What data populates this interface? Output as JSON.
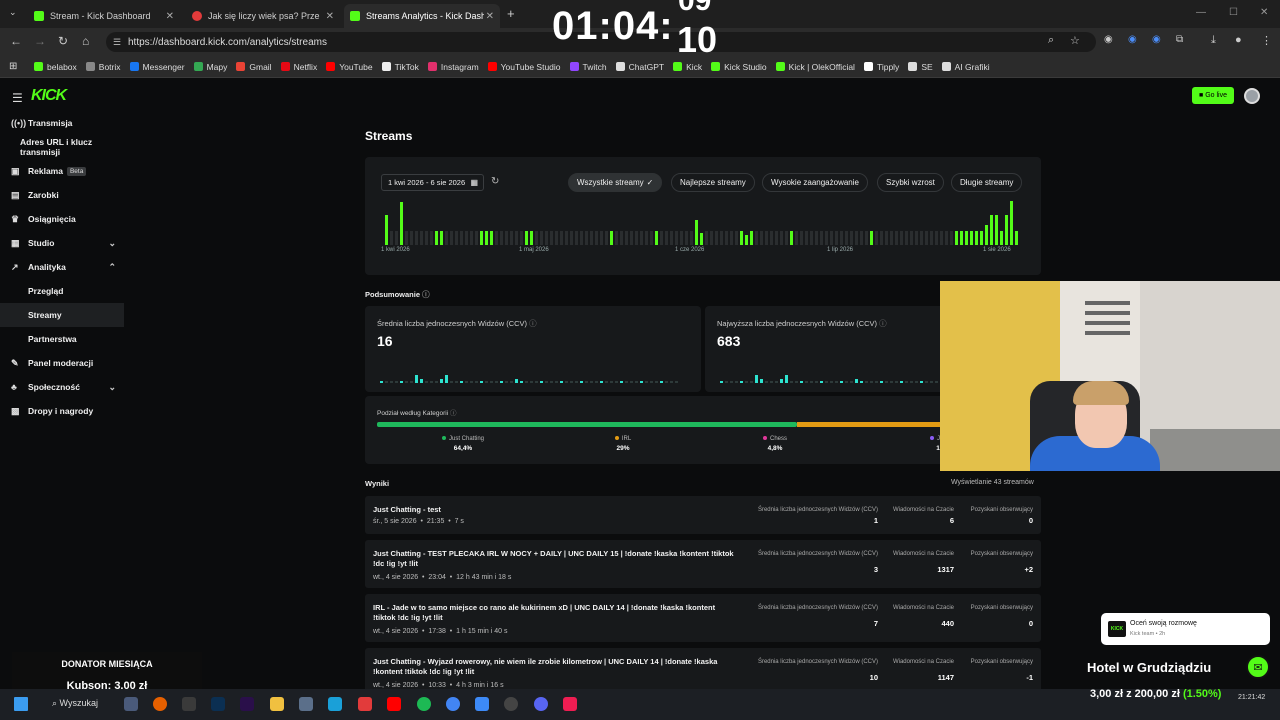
{
  "browser": {
    "tabs": [
      {
        "label": "Stream - Kick Dashboard"
      },
      {
        "label": "Jak się liczy wiek psa? Przelicznik"
      },
      {
        "label": "Streams Analytics - Kick Dashb"
      }
    ],
    "url": "https://dashboard.kick.com/analytics/streams",
    "bookmarks": [
      "belabox",
      "Botrix",
      "Messenger",
      "Mapy",
      "Gmail",
      "Netflix",
      "YouTube",
      "TikTok",
      "Instagram",
      "YouTube Studio",
      "Twitch",
      "ChatGPT",
      "Kick",
      "Kick Studio",
      "Kick | OlekOfficial",
      "Tipply",
      "SE",
      "AI Grafiki"
    ]
  },
  "overlay": {
    "clock": "01:04:",
    "clock_sec": "10",
    "clock_sec_prev": "09",
    "donor_title": "DONATOR MIESIĄCA",
    "donor_value": "Kubson: 3,00 zł",
    "notif_title": "Oceń swoją rozmowę",
    "notif_sub": "Kick team • 2h",
    "goal_title": "Hotel w Grudziądziu",
    "goal_value": "3,00 zł z 200,00 zł",
    "goal_pct": "(1.50%)"
  },
  "header": {
    "logo": "KICK",
    "go_live": "Go live"
  },
  "sidebar": {
    "items": [
      {
        "label": "Transmisja"
      },
      {
        "label": "Adres URL i klucz transmisji"
      },
      {
        "label": "Reklama",
        "badge": "Beta"
      },
      {
        "label": "Zarobki"
      },
      {
        "label": "Osiągnięcia"
      },
      {
        "label": "Studio"
      },
      {
        "label": "Analityka"
      },
      {
        "label": "Przegląd"
      },
      {
        "label": "Streamy"
      },
      {
        "label": "Partnerstwa"
      },
      {
        "label": "Panel moderacji"
      },
      {
        "label": "Społeczność"
      },
      {
        "label": "Dropy i nagrody"
      }
    ]
  },
  "main": {
    "title": "Streams",
    "date_range": "1 kwi 2026 - 6 sie 2026",
    "filters": [
      "Wszystkie streamy",
      "Najlepsze streamy",
      "Wysokie zaangażowanie",
      "Szybki wzrost",
      "Długie streamy"
    ],
    "axis_labels": [
      "1 kwi 2026",
      "1 maj 2026",
      "1 cze 2026",
      "1 lip 2026",
      "1 sie 2026"
    ],
    "summary_label": "Podsumowanie",
    "stats": [
      {
        "title": "Średnia liczba jednoczesnych Widzów (CCV)",
        "value": "16"
      },
      {
        "title": "Najwyższa liczba jednoczesnych Widzów (CCV)",
        "value": "683"
      }
    ],
    "categories_title": "Podział według Kategorii",
    "categories": [
      {
        "name": "Just Chatting",
        "pct": "64,4%",
        "color": "#1fb85c"
      },
      {
        "name": "IRL",
        "pct": "29%",
        "color": "#e39b14"
      },
      {
        "name": "Chess",
        "pct": "4,8%",
        "color": "#e0389a"
      },
      {
        "name": "Just",
        "pct": "1,",
        "color": "#8b5cf6"
      }
    ],
    "results_label": "Wyniki",
    "results_count": "Wyświetlanie 43 streamów",
    "col_ccv": "Średnia liczba jednoczesnych Widzów (CCV)",
    "col_msgs": "Wiadomości na Czacie",
    "col_follows": "Pozyskani obserwujący",
    "rows": [
      {
        "title": "Just Chatting - test",
        "day": "śr., 5 sie 2026",
        "time": "21:35",
        "dur": "7 s",
        "ccv": "1",
        "msgs": "6",
        "follows": "0"
      },
      {
        "title": "Just Chatting - TEST PLECAKA IRL W NOCY + DAILY | UNC DAILY 15 | !donate !kaska !kontent !tiktok !dc !ig !yt !lit",
        "day": "wt., 4 sie 2026",
        "time": "23:04",
        "dur": "12 h 43 min i 18 s",
        "ccv": "3",
        "msgs": "1317",
        "follows": "+2"
      },
      {
        "title": "IRL - Jade w to samo miejsce co rano ale kukirinem xD | UNC DAILY 14 | !donate !kaska !kontent !tiktok !dc !ig !yt !lit",
        "day": "wt., 4 sie 2026",
        "time": "17:38",
        "dur": "1 h 15 min i 40 s",
        "ccv": "7",
        "msgs": "440",
        "follows": "0"
      },
      {
        "title": "Just Chatting - Wyjazd rowerowy, nie wiem ile zrobie kilometrow | UNC DAILY 14 | !donate !kaska !kontent !tiktok !dc !ig !yt !lit",
        "day": "wt., 4 sie 2026",
        "time": "10:33",
        "dur": "4 h 3 min i 16 s",
        "ccv": "10",
        "msgs": "1147",
        "follows": "-1"
      }
    ]
  },
  "taskbar": {
    "search": "Wyszukaj",
    "time": "21:21:42"
  }
}
